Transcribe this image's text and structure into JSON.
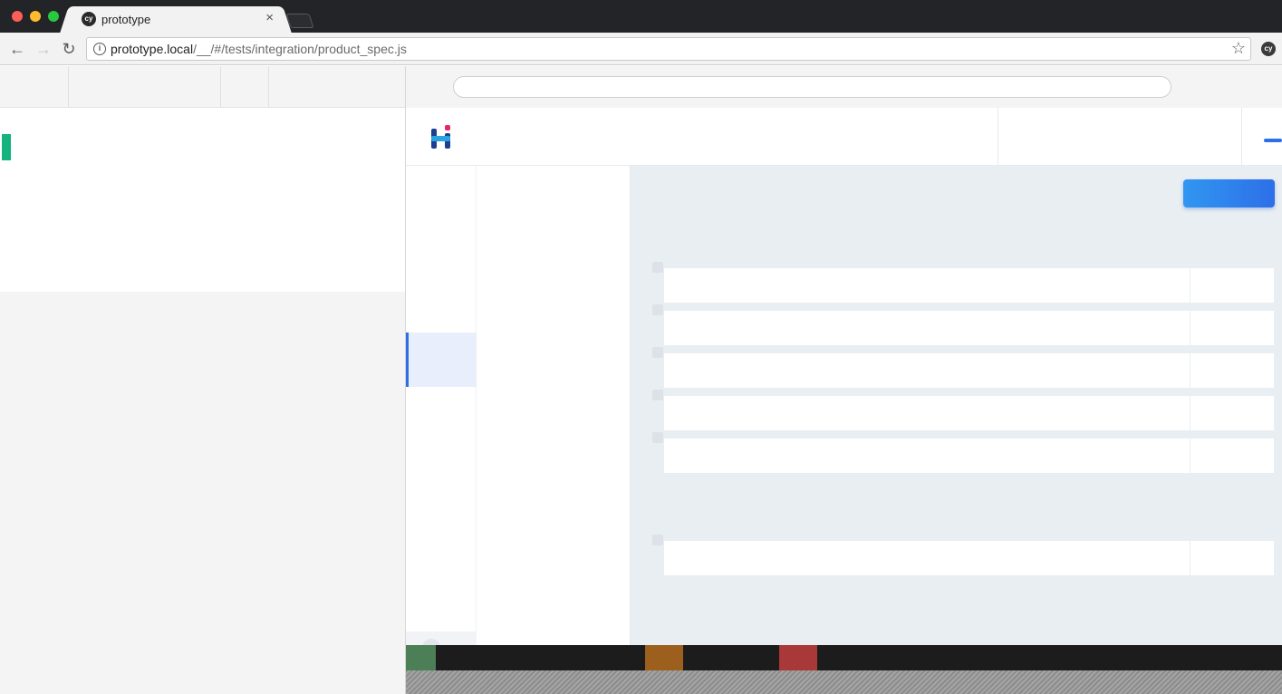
{
  "browser": {
    "tab_title": "prototype",
    "tab_favicon_text": "cy",
    "close_glyph": "×",
    "url_host": "prototype.local",
    "url_path": "/__/#/tests/integration/product_spec.js",
    "extension_icon_text": "cy"
  },
  "icons": {
    "back": "arrow-left-icon",
    "forward": "arrow-right-icon",
    "reload": "reload-icon",
    "info": "info-icon",
    "star": "star-icon"
  },
  "colors": {
    "test_status": "#14b37d",
    "accent": "#2d6fe8",
    "button_gradient_start": "#3196f1",
    "command_pass": "#4c7f55",
    "command_warn": "#9c5f1d",
    "command_fail": "#a93838"
  },
  "app": {
    "primary_button_label": "",
    "rows": [
      {},
      {},
      {},
      {},
      {},
      {}
    ]
  }
}
